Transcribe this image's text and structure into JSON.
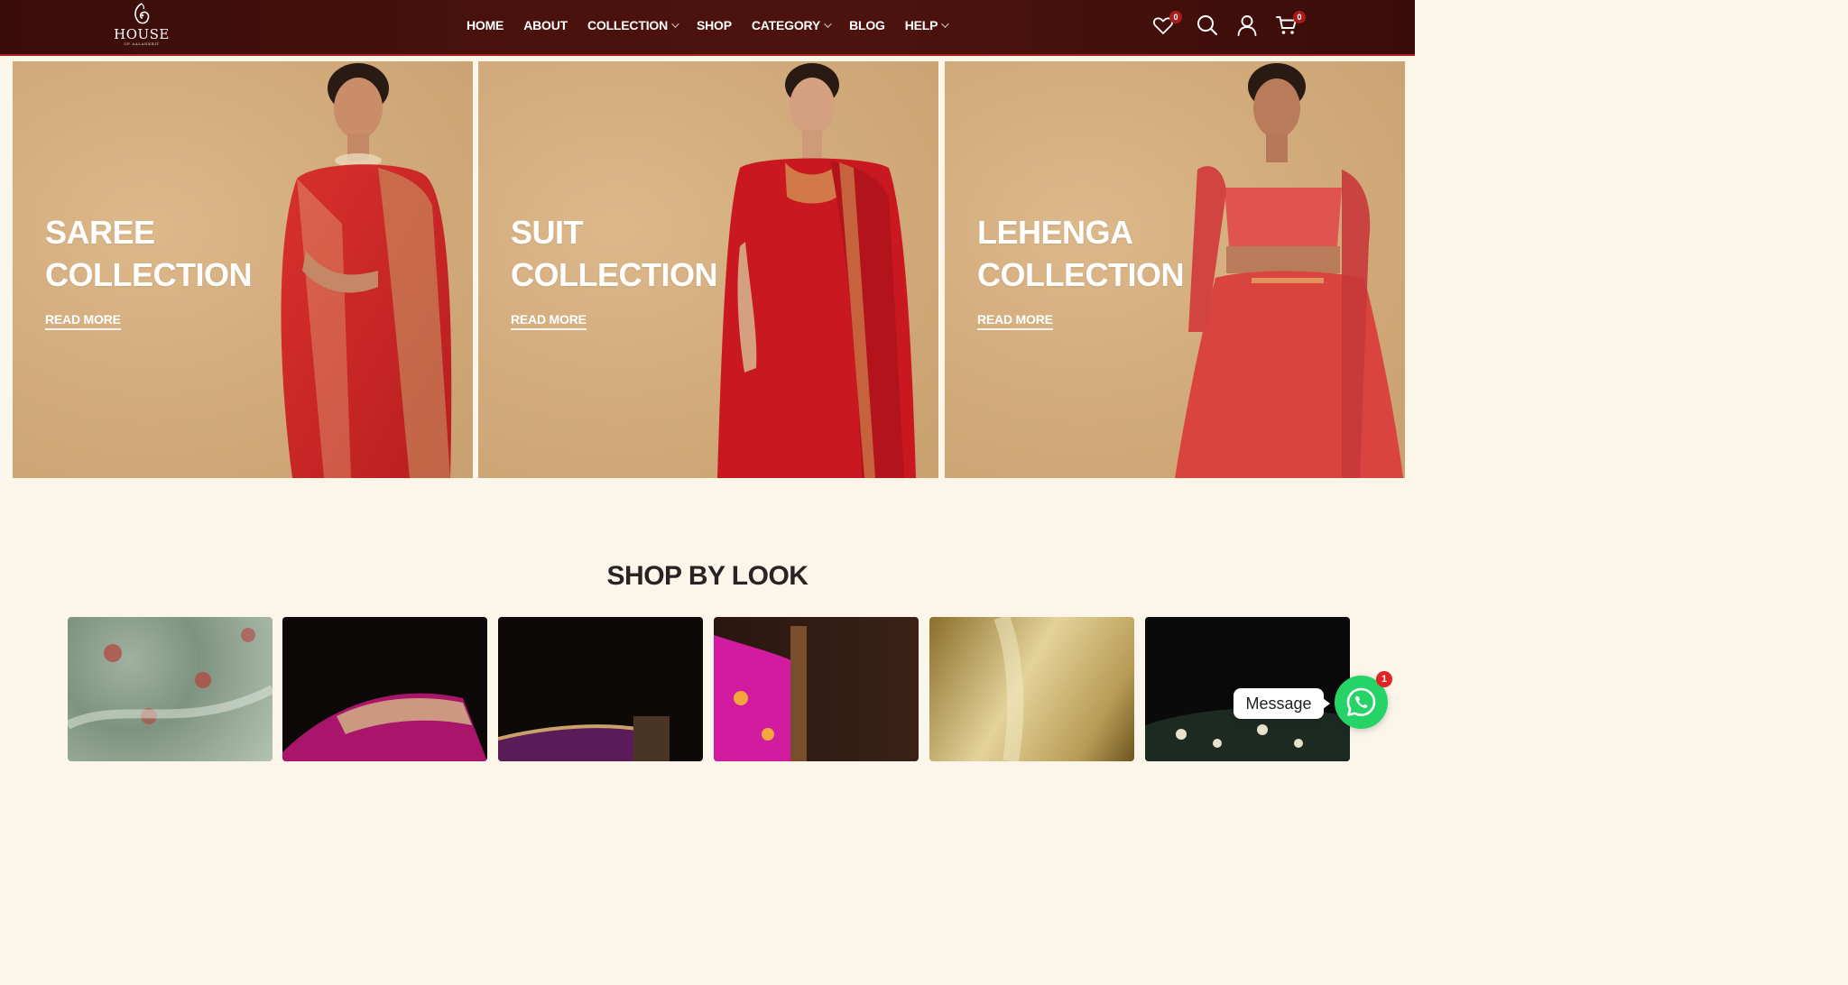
{
  "brand": {
    "name": "HOUSE",
    "tagline": "OF AALANKRIT"
  },
  "nav": {
    "items": [
      {
        "label": "HOME",
        "has_dropdown": false
      },
      {
        "label": "ABOUT",
        "has_dropdown": false
      },
      {
        "label": "COLLECTION",
        "has_dropdown": true
      },
      {
        "label": "SHOP",
        "has_dropdown": false
      },
      {
        "label": "CATEGORY",
        "has_dropdown": true
      },
      {
        "label": "BLOG",
        "has_dropdown": false
      },
      {
        "label": "HELP",
        "has_dropdown": true
      }
    ]
  },
  "header_icons": {
    "wishlist": {
      "icon": "heart-icon",
      "count": "0"
    },
    "search": {
      "icon": "search-icon"
    },
    "account": {
      "icon": "user-icon"
    },
    "cart": {
      "icon": "cart-icon",
      "count": "0"
    }
  },
  "banners": [
    {
      "title_line1": "SAREE",
      "title_line2": "COLLECTION",
      "link": "READ MORE"
    },
    {
      "title_line1": "SUIT",
      "title_line2": "COLLECTION",
      "link": "READ MORE"
    },
    {
      "title_line1": "LEHENGA",
      "title_line2": "COLLECTION",
      "link": "READ MORE"
    }
  ],
  "shop_by_look": {
    "title": "SHOP BY LOOK"
  },
  "chat": {
    "message_label": "Message",
    "unread_count": "1",
    "icon": "whatsapp-icon"
  },
  "colors": {
    "header_bg": "#4a120d",
    "accent_red": "#a8231b",
    "page_bg": "#fbf5ea",
    "banner_bg": "#d3ac7d",
    "whatsapp_green": "#25d366"
  }
}
